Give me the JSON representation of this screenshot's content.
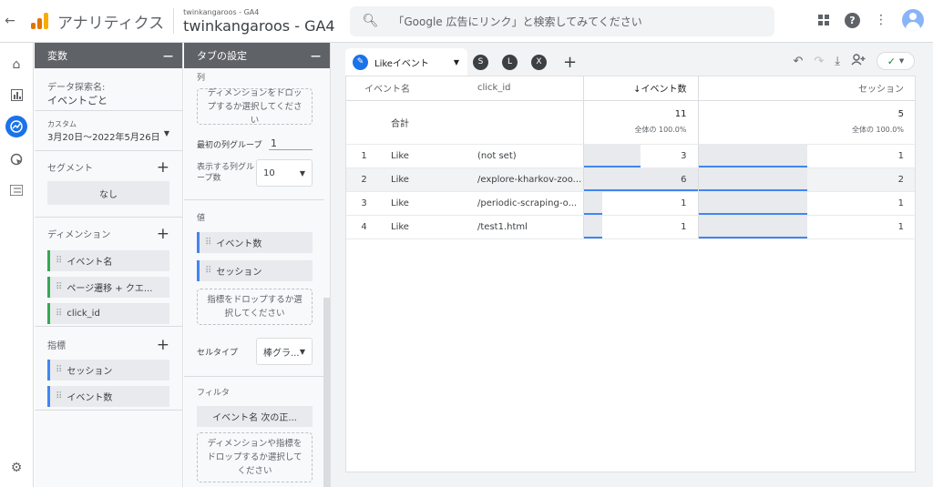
{
  "header": {
    "back_icon": "arrow-left-icon",
    "app_title": "アナリティクス",
    "property_account": "twinkangaroos - GA4",
    "property_name": "twinkangaroos - GA4",
    "search_placeholder": "「Google 広告にリンク」と検索してみてください"
  },
  "colors": {
    "accent": "#1a73e8",
    "panel_header": "#5f6368",
    "dimension": "#34a853",
    "metric": "#4285f4",
    "logo": [
      "#f9ab00",
      "#e37400",
      "#e37400"
    ]
  },
  "variables": {
    "title": "変数",
    "minimize": "—",
    "exploration_label": "データ探索名:",
    "exploration_name": "イベントごと",
    "date_label": "カスタム",
    "date_range": "3月20日～2022年5月26日",
    "segments_title": "セグメント",
    "segments_none": "なし",
    "dimensions_title": "ディメンション",
    "dimensions": [
      "イベント名",
      "ページ遷移 + クエ...",
      "click_id"
    ],
    "metrics_title": "指標",
    "metrics": [
      "セッション",
      "イベント数"
    ]
  },
  "tab_settings": {
    "title": "タブの設定",
    "minimize": "—",
    "columns_title": "列",
    "columns_drop": "ディメンションをドロップするか選択してください",
    "first_group_label": "最初の列グループ",
    "first_group_value": "1",
    "rows_per_group_label": "表示する列グループ数",
    "rows_per_group_value": "10",
    "values_title": "値",
    "values": [
      "イベント数",
      "セッション"
    ],
    "values_drop": "指標をドロップするか選択してください",
    "cell_type_label": "セルタイプ",
    "cell_type_value": "棒グラ...",
    "filters_title": "フィルタ",
    "filter_chip": "イベント名 次の正...",
    "filters_drop": "ディメンションや指標をドロップするか選択してください"
  },
  "tabs": {
    "active": "Likeイベント",
    "others": [
      "S",
      "L",
      "X"
    ],
    "add": "+"
  },
  "table": {
    "headers": [
      "イベント名",
      "click_id",
      "↓イベント数",
      "セッション"
    ],
    "total": {
      "label": "合計",
      "events": "11",
      "events_pct": "全体の 100.0%",
      "sessions": "5",
      "sessions_pct": "全体の 100.0%"
    },
    "rows": [
      {
        "idx": "1",
        "name": "Like",
        "click_id": "(not set)",
        "events": "3",
        "sessions": "1",
        "events_ratio": 0.5,
        "sessions_ratio": 1.0
      },
      {
        "idx": "2",
        "name": "Like",
        "click_id": "/explore-kharkov-zoo...",
        "events": "6",
        "sessions": "2",
        "events_ratio": 1.0,
        "sessions_ratio": 1.0
      },
      {
        "idx": "3",
        "name": "Like",
        "click_id": "/periodic-scraping-o...",
        "events": "1",
        "sessions": "1",
        "events_ratio": 0.167,
        "sessions_ratio": 1.0
      },
      {
        "idx": "4",
        "name": "Like",
        "click_id": "/test1.html",
        "events": "1",
        "sessions": "1",
        "events_ratio": 0.167,
        "sessions_ratio": 1.0
      }
    ]
  }
}
